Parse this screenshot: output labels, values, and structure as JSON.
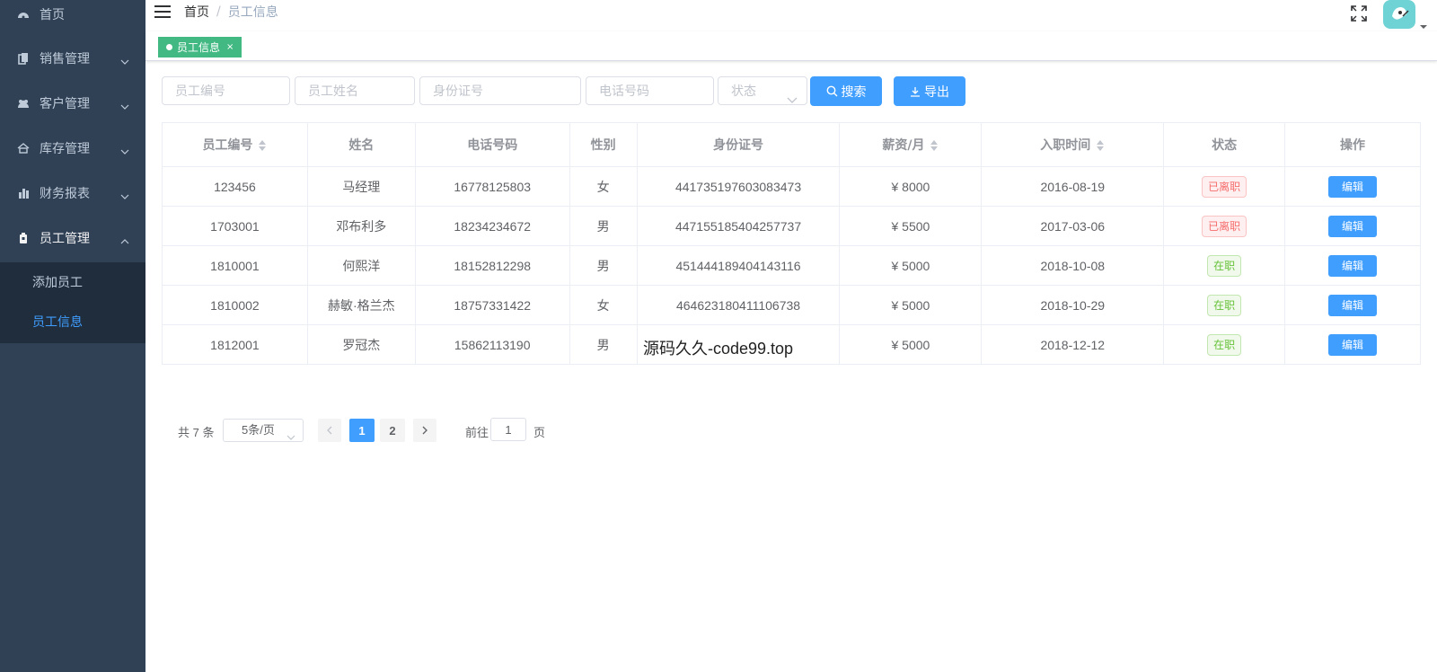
{
  "sidebar": {
    "items": [
      {
        "label": "首页"
      },
      {
        "label": "销售管理"
      },
      {
        "label": "客户管理"
      },
      {
        "label": "库存管理"
      },
      {
        "label": "财务报表"
      },
      {
        "label": "员工管理"
      }
    ],
    "submenu": [
      {
        "label": "添加员工"
      },
      {
        "label": "员工信息"
      }
    ]
  },
  "breadcrumb": {
    "home": "首页",
    "separator": "/",
    "current": "员工信息"
  },
  "tag": {
    "label": "员工信息",
    "close": "×"
  },
  "filters": {
    "employee_no_placeholder": "员工编号",
    "name_placeholder": "员工姓名",
    "id_card_placeholder": "身份证号",
    "phone_placeholder": "电话号码",
    "status_placeholder": "状态",
    "search_label": "搜索",
    "export_label": "导出"
  },
  "table": {
    "headers": [
      "员工编号",
      "姓名",
      "电话号码",
      "性别",
      "身份证号",
      "薪资/月",
      "入职时间",
      "状态",
      "操作"
    ],
    "rows": [
      {
        "no": "123456",
        "name": "马经理",
        "phone": "16778125803",
        "gender": "女",
        "id_card": "441735197603083473",
        "salary": "¥ 8000",
        "date": "2016-08-19",
        "status": "已离职",
        "action": "编辑"
      },
      {
        "no": "1703001",
        "name": "邓布利多",
        "phone": "18234234672",
        "gender": "男",
        "id_card": "447155185404257737",
        "salary": "¥ 5500",
        "date": "2017-03-06",
        "status": "已离职",
        "action": "编辑"
      },
      {
        "no": "1810001",
        "name": "何熙洋",
        "phone": "18152812298",
        "gender": "男",
        "id_card": "451444189404143116",
        "salary": "¥ 5000",
        "date": "2018-10-08",
        "status": "在职",
        "action": "编辑"
      },
      {
        "no": "1810002",
        "name": "赫敏·格兰杰",
        "phone": "18757331422",
        "gender": "女",
        "id_card": "464623180411106738",
        "salary": "¥ 5000",
        "date": "2018-10-29",
        "status": "在职",
        "action": "编辑"
      },
      {
        "no": "1812001",
        "name": "罗冠杰",
        "phone": "15862113190",
        "gender": "男",
        "id_card": "",
        "salary": "¥ 5000",
        "date": "2018-12-12",
        "status": "在职",
        "action": "编辑"
      }
    ]
  },
  "watermark": "源码久久-code99.top",
  "pagination": {
    "total": "共 7 条",
    "page_size": "5条/页",
    "pages": [
      "1",
      "2"
    ],
    "goto_label": "前往",
    "goto_value": "1",
    "page_word": "页"
  },
  "colors": {
    "sidebar_bg": "#304156",
    "primary": "#409eff",
    "tag_green": "#42b983",
    "danger": "#f56c6c",
    "success": "#67c23a"
  }
}
